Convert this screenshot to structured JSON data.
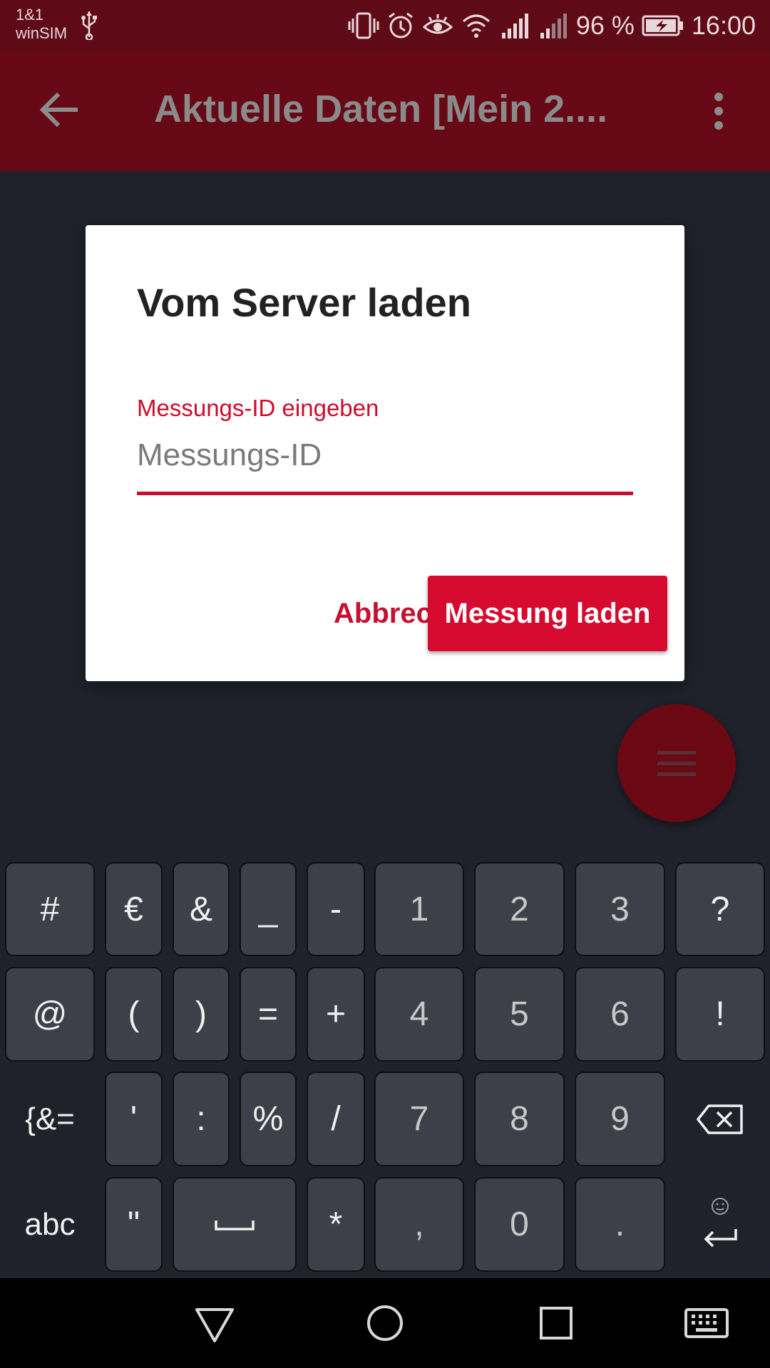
{
  "status_bar": {
    "carrier_line1": "1&1",
    "carrier_line2": "winSIM",
    "battery_text": "96 %",
    "time": "16:00",
    "icons": [
      "usb-icon",
      "vibrate-icon",
      "alarm-icon",
      "eye-comfort-icon",
      "wifi-icon",
      "signal-icon",
      "signal-icon-2",
      "battery-charging-icon"
    ]
  },
  "app_bar": {
    "title": "Aktuelle Daten [Mein 2...."
  },
  "dialog": {
    "title": "Vom Server laden",
    "field_label": "Messungs-ID eingeben",
    "field_placeholder": "Messungs-ID",
    "field_value": "",
    "cancel_label": "Abbrechen",
    "confirm_label": "Messung laden"
  },
  "fab": {
    "icon": "menu-icon"
  },
  "keyboard": {
    "rows": [
      [
        "#",
        "€",
        "&",
        "_",
        "-",
        "1",
        "2",
        "3",
        "?"
      ],
      [
        "@",
        "(",
        ")",
        "=",
        "+",
        "4",
        "5",
        "6",
        "!"
      ],
      [
        "{&=",
        "'",
        ":",
        "%",
        "/",
        "7",
        "8",
        "9",
        "⌫"
      ],
      [
        "abc",
        "\"",
        "␣",
        "*",
        ",",
        "0",
        ".",
        "↵"
      ]
    ]
  },
  "nav_bar": {
    "icons": [
      "back-triangle-icon",
      "home-circle-icon",
      "recents-square-icon",
      "keyboard-icon"
    ]
  },
  "colors": {
    "status_bar": "#5e0a17",
    "app_bar": "#660815",
    "accent": "#d60a2e",
    "scrim_background": "#1f222b",
    "key": "#3d4048"
  }
}
